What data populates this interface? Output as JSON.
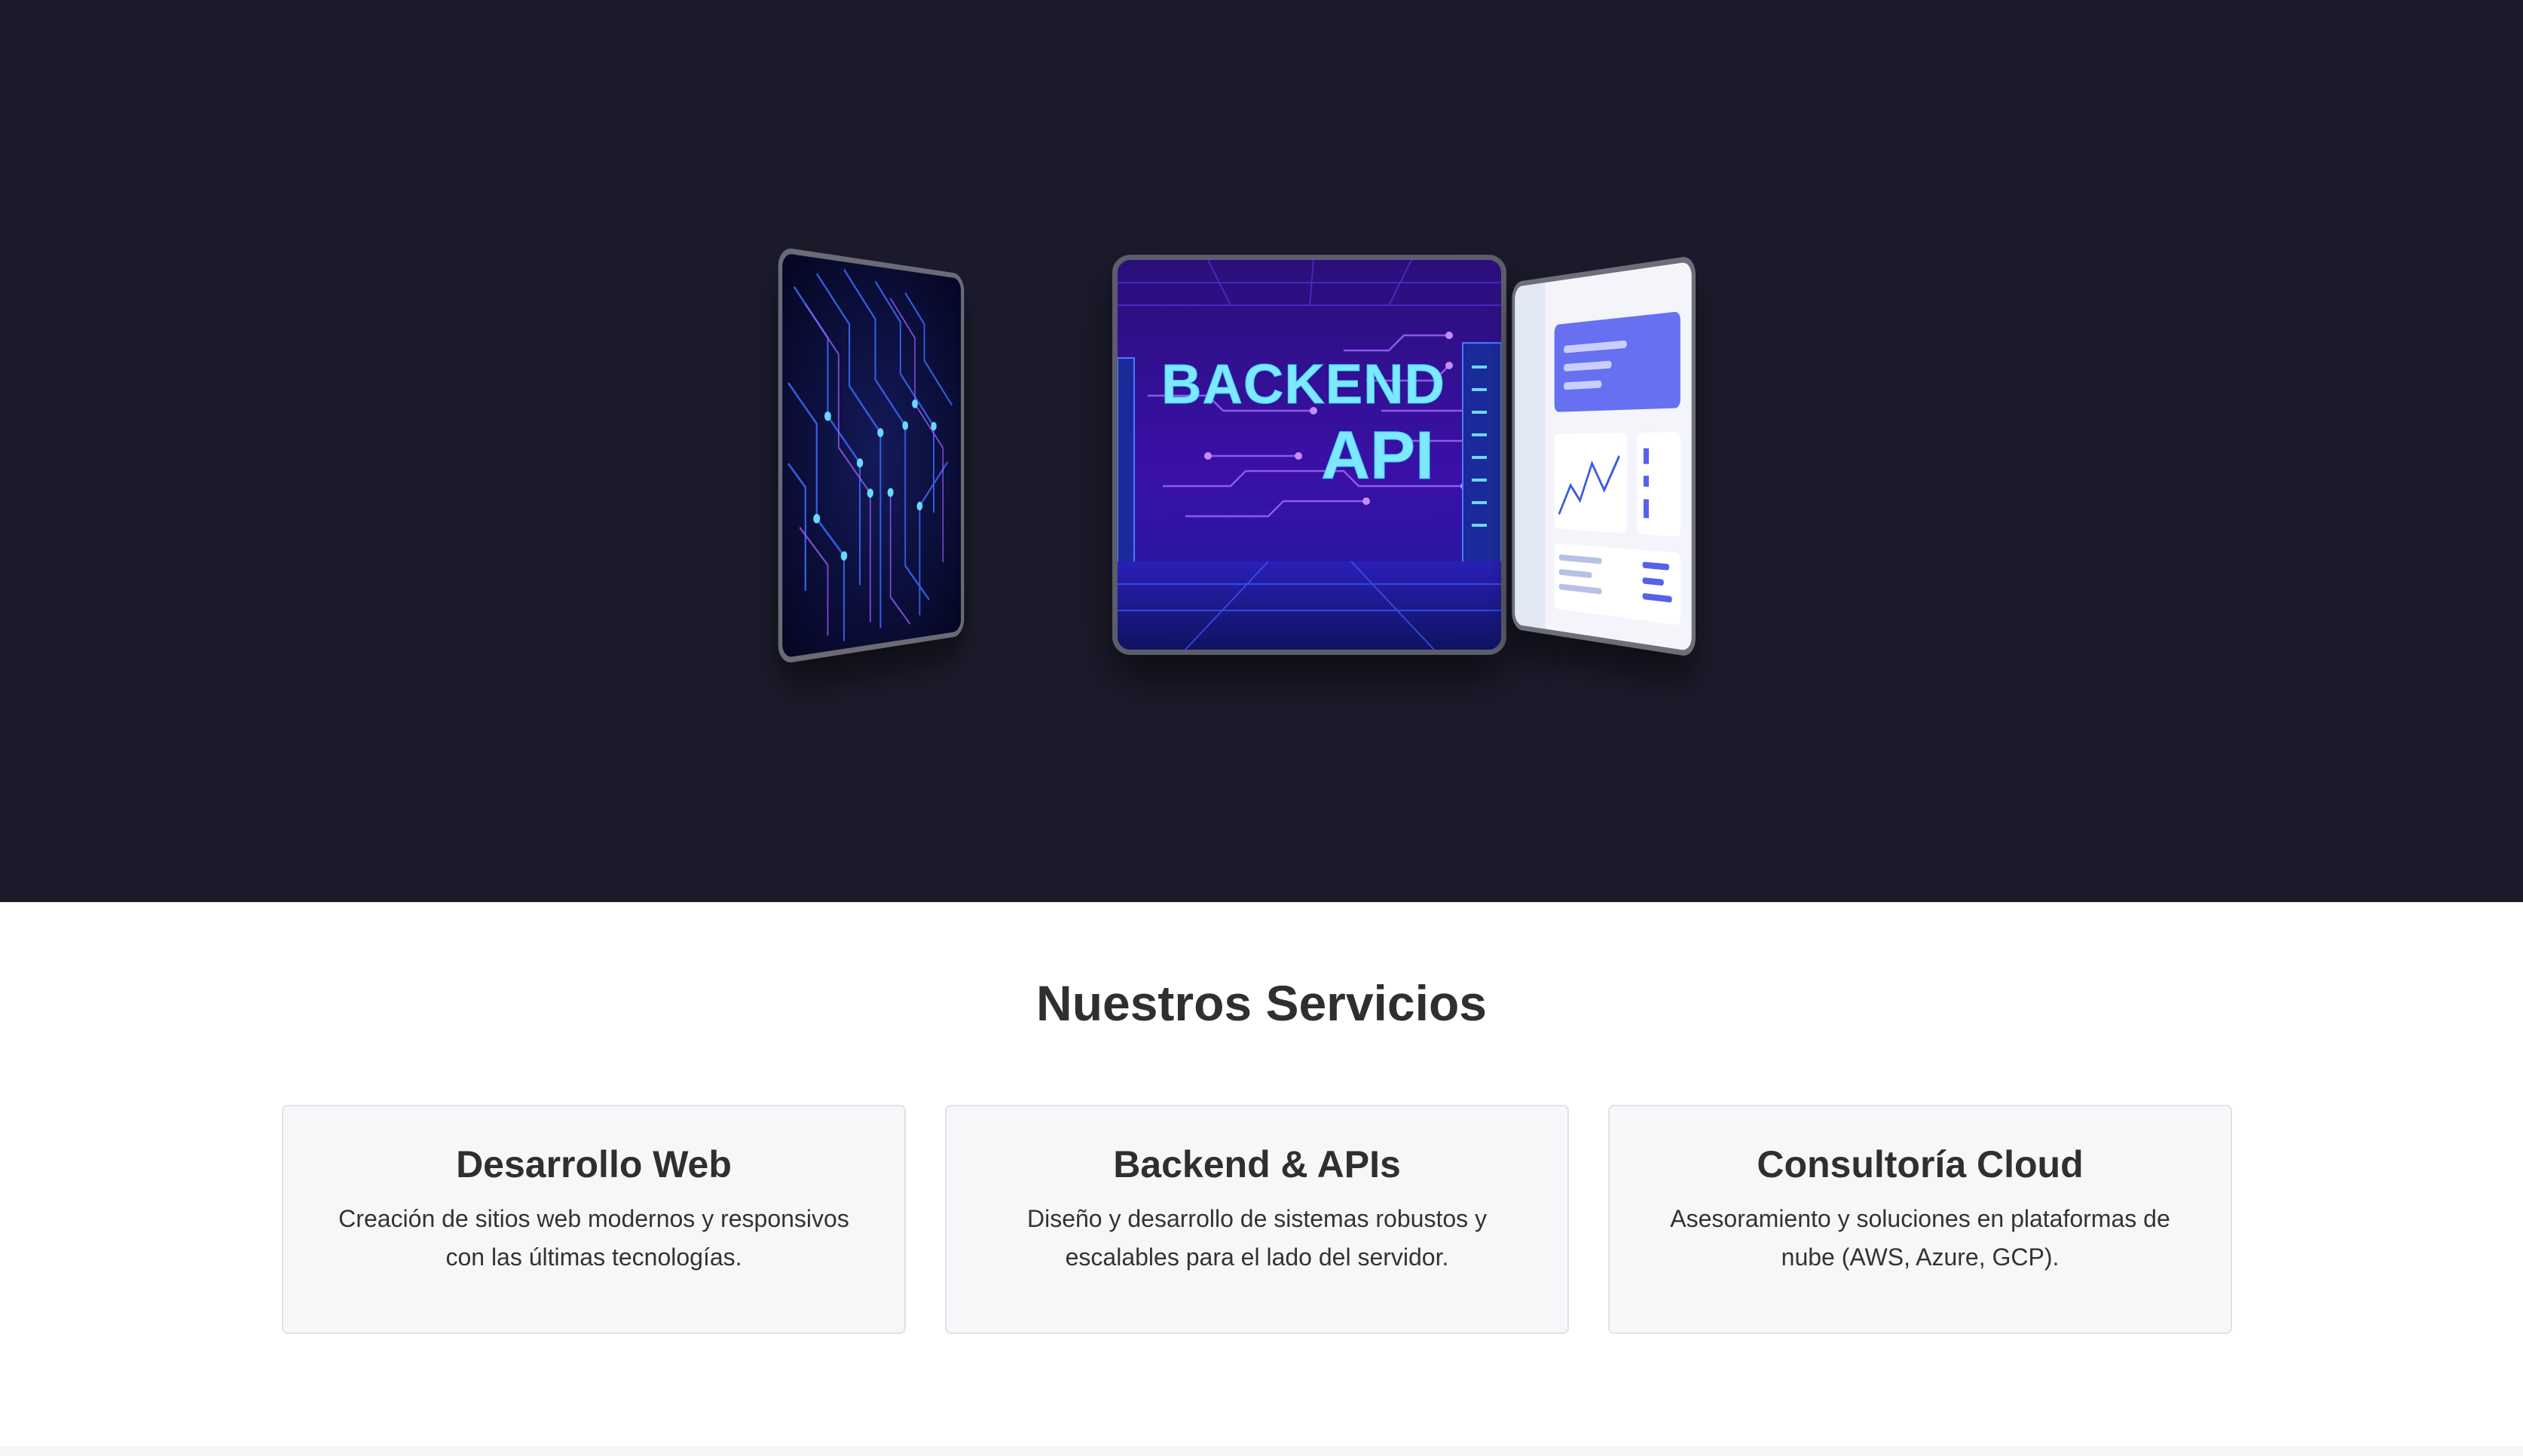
{
  "carousel": {
    "center_card": {
      "line1": "BACKEND",
      "line2": "API"
    }
  },
  "services": {
    "title": "Nuestros Servicios",
    "items": [
      {
        "title": "Desarrollo Web",
        "description": "Creación de sitios web modernos y responsivos con las últimas tecnologías."
      },
      {
        "title": "Backend & APIs",
        "description": "Diseño y desarrollo de sistemas robustos y escalables para el lado del servidor."
      },
      {
        "title": "Consultoría Cloud",
        "description": "Asesoramiento y soluciones en plataformas de nube (AWS, Azure, GCP)."
      }
    ]
  },
  "colors": {
    "hero_background": "#1b1b2c",
    "card_background": "#f6f7f9",
    "text": "#333333",
    "neon": "#7fe7ff"
  }
}
